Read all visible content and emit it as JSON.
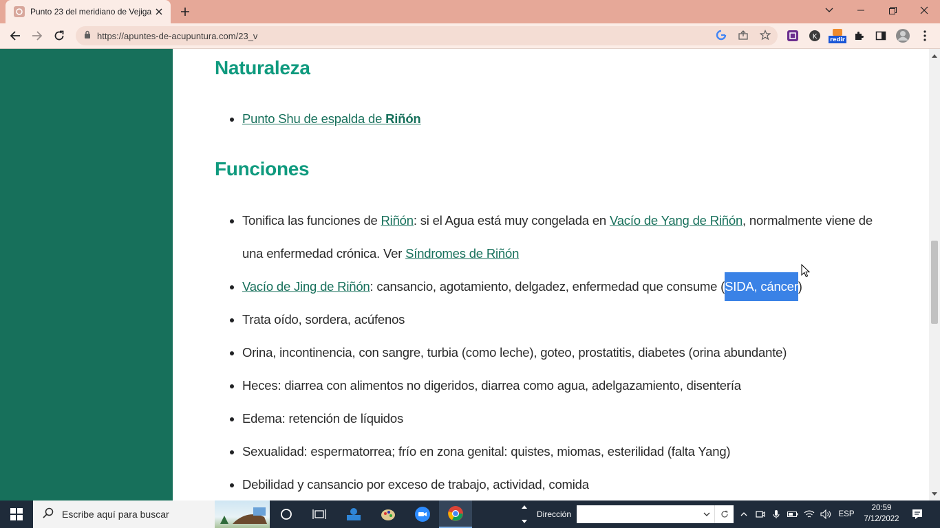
{
  "browser": {
    "tab_title": "Punto 23 del meridiano de Vejiga",
    "url": "https://apuntes-de-acupuntura.com/23_v",
    "extension_badge": "redir"
  },
  "page": {
    "section1_heading": "Naturaleza",
    "section1_items": [
      {
        "link_text": "Punto Shu de espalda de ",
        "link_bold": "Riñón"
      }
    ],
    "section2_heading": "Funciones",
    "item1": {
      "prefix": "Tonifica las funciones de ",
      "link1": "Riñón",
      "mid": ": si el Agua está muy congelada en ",
      "link2": "Vacío de Yang de Riñón",
      "suffix": ", normalmente viene de",
      "line2_prefix": "una enfermedad crónica. Ver ",
      "link3": "Síndromes de Riñón"
    },
    "item2": {
      "link": "Vacío de Jing de Riñón",
      "text": ": cansancio, agotamiento, delgadez, enfermedad que consume (",
      "selected": "SIDA, cáncer",
      "end": ")"
    },
    "items": [
      "Trata oído, sordera, acúfenos",
      "Orina, incontinencia, con sangre, turbia (como leche), goteo, prostatitis, diabetes (orina abundante)",
      "Heces: diarrea con alimentos no digeridos, diarrea como agua, adelgazamiento, disentería",
      "Edema: retención de líquidos",
      "Sexualidad: espermatorrea; frío en zona genital: quistes, miomas, esterilidad (falta Yang)",
      "Debilidad y cansancio por exceso de trabajo, actividad, comida"
    ]
  },
  "taskbar": {
    "search_placeholder": "Escribe aquí para buscar",
    "address_label": "Dirección",
    "language": "ESP",
    "time": "20:59",
    "date": "7/12/2022"
  },
  "colors": {
    "sidebar": "#17705b",
    "heading": "#0f9a7e",
    "link": "#17705b",
    "selection": "#3a82e6",
    "tabstrip": "#e6a898"
  }
}
